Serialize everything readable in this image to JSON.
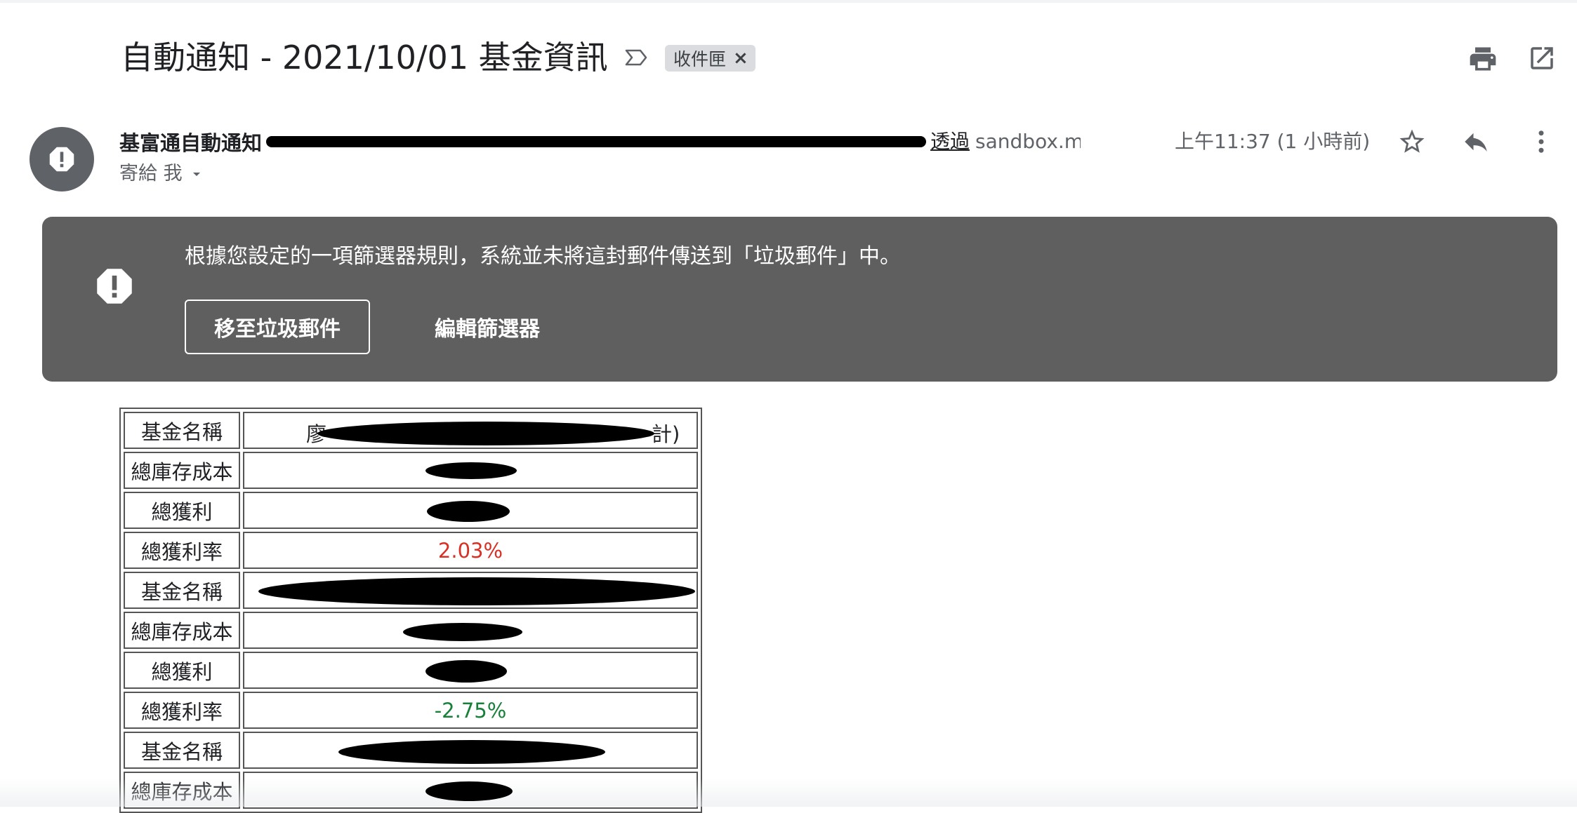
{
  "email": {
    "subject": "自動通知 - 2021/10/01 基金資訊",
    "label_chip": "收件匣",
    "label_chip_remove": "×"
  },
  "sender": {
    "name": "基富通自動通知",
    "via": "透過",
    "via_domain": "sandbox.mgsend…",
    "time": "上午11:37 (1 小時前)",
    "recipient": "寄給 我"
  },
  "spam_banner": {
    "message": "根據您設定的一項篩選器規則，系統並未將這封郵件傳送到「垃圾郵件」中。",
    "move_button": "移至垃圾郵件",
    "edit_filter_button": "編輯篩選器"
  },
  "fund_table": {
    "rows": [
      {
        "label": "基金名稱",
        "value": "廖"
      },
      {
        "label": "總庫存成本",
        "value": ""
      },
      {
        "label": "總獲利",
        "value": ""
      },
      {
        "label": "總獲利率",
        "value": "2.03%"
      },
      {
        "label": "基金名稱",
        "value": ""
      },
      {
        "label": "總庫存成本",
        "value": ""
      },
      {
        "label": "總獲利",
        "value": ""
      },
      {
        "label": "總獲利率",
        "value": "-2.75%"
      },
      {
        "label": "基金名稱",
        "value": ""
      },
      {
        "label": "總庫存成本",
        "value": ""
      }
    ]
  },
  "colors": {
    "positive": "#d93025",
    "negative": "#188038",
    "banner_bg": "#5f5f5f",
    "chip_bg": "#dadce0"
  },
  "icons": [
    "important-icon",
    "print-icon",
    "open-new-window-icon",
    "alert-icon",
    "star-icon",
    "reply-icon",
    "more-vert-icon",
    "dropdown-arrow-icon"
  ]
}
